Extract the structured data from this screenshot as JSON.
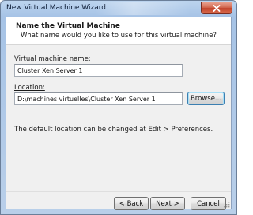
{
  "window": {
    "title": "New Virtual Machine Wizard"
  },
  "header": {
    "title": "Name the Virtual Machine",
    "subtitle": "What name would you like to use for this virtual machine?"
  },
  "form": {
    "vm_name_label": "Virtual machine name:",
    "vm_name_value": "Cluster Xen Server 1",
    "location_label": "Location:",
    "location_value": "D:\\machines virtuelles\\Cluster Xen Server 1",
    "browse_label": "Browse...",
    "info_text": "The default location can be changed at Edit > Preferences."
  },
  "footer": {
    "back_label": "< Back",
    "next_label": "Next >",
    "cancel_label": "Cancel"
  },
  "icons": {
    "close": "close-icon",
    "grip": "resize-grip-icon"
  },
  "colors": {
    "titlebar": "#a6c3e6",
    "close_button": "#c1412a",
    "dialog_bg": "#f0f0f0"
  }
}
